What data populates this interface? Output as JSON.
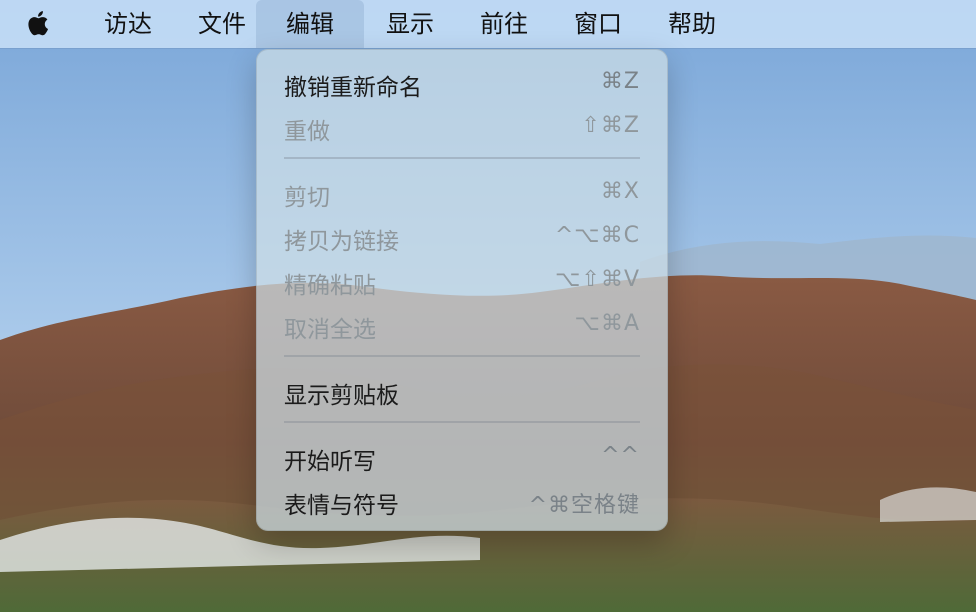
{
  "menubar": {
    "apple_icon": "apple-logo-icon",
    "items": [
      {
        "label": "访达",
        "active": false
      },
      {
        "label": "文件",
        "active": false
      },
      {
        "label": "编辑",
        "active": true
      },
      {
        "label": "显示",
        "active": false
      },
      {
        "label": "前往",
        "active": false
      },
      {
        "label": "窗口",
        "active": false
      },
      {
        "label": "帮助",
        "active": false
      }
    ]
  },
  "edit_menu": {
    "items": [
      {
        "label": "撤销重新命名",
        "shortcut": "⌘Z",
        "enabled": true
      },
      {
        "label": "重做",
        "shortcut": "⇧⌘Z",
        "enabled": false
      },
      {
        "label": "剪切",
        "shortcut": "⌘X",
        "enabled": false
      },
      {
        "label": "拷贝为链接",
        "shortcut": "^⌥⌘C",
        "enabled": false
      },
      {
        "label": "精确粘贴",
        "shortcut": "⌥⇧⌘V",
        "enabled": false
      },
      {
        "label": "取消全选",
        "shortcut": "⌥⌘A",
        "enabled": false
      },
      {
        "label": "显示剪贴板",
        "shortcut": "",
        "enabled": true
      },
      {
        "label": "开始听写",
        "shortcut": "^^",
        "enabled": true
      },
      {
        "label": "表情与符号",
        "shortcut": "^⌘空格键",
        "enabled": true
      }
    ]
  },
  "colors": {
    "sky": "#8fb7e4",
    "menubar_bg": "#c6def6",
    "menu_bg": "#cddee6",
    "disabled_text": "#8f979c"
  }
}
